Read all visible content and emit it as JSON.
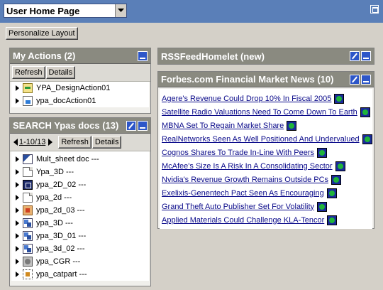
{
  "window": {
    "page_select_value": "User Home Page",
    "maximize_icon": "maximize-icon"
  },
  "toolbar": {
    "personalize_label": "Personalize Layout"
  },
  "my_actions": {
    "title": "My Actions (2)",
    "refresh_label": "Refresh",
    "details_label": "Details",
    "items": [
      {
        "label": "YPA_DesignAction01",
        "icon": "design-action-icon"
      },
      {
        "label": "ypa_docAction01",
        "icon": "doc-action-icon"
      }
    ]
  },
  "search": {
    "title": "SEARCH Ypas docs (13)",
    "pager_label": "1-10/13",
    "refresh_label": "Refresh",
    "details_label": "Details",
    "items": [
      {
        "label": "Mult_sheet doc ---",
        "icon": "multi-sheet-doc-icon"
      },
      {
        "label": "Ypa_3D ---",
        "icon": "document-icon"
      },
      {
        "label": "ypa_2D_02 ---",
        "icon": "drawing-icon"
      },
      {
        "label": "ypa_2d ---",
        "icon": "document-icon"
      },
      {
        "label": "ypa_2d_03 ---",
        "icon": "part-icon"
      },
      {
        "label": "ypa_3D ---",
        "icon": "product-icon"
      },
      {
        "label": "ypa_3D_01 ---",
        "icon": "product-icon"
      },
      {
        "label": "ypa_3d_02 ---",
        "icon": "product-icon"
      },
      {
        "label": "ypa_CGR ---",
        "icon": "cgr-icon"
      },
      {
        "label": "ypa_catpart ---",
        "icon": "catpart-icon"
      }
    ]
  },
  "rss_homelet": {
    "title": "RSSFeedHomelet (new)"
  },
  "forbes": {
    "title": "Forbes.com Financial Market News (10)",
    "items": [
      "Agere's Revenue Could Drop 10% In Fiscal 2005",
      "Satellite Radio Valuations Need To Come Down To Earth",
      "MBNA Set To Regain Market Share",
      "RealNetworks Seen As Well Positioned And Undervalued",
      "Cognos Shares To Trade In-Line With Peers",
      "McAfee's Size Is A Risk In A Consolidating Sector",
      "Nvidia's Revenue Growth Remains Outside PCs",
      "Exelixis-Genentech Pact Seen As Encouraging",
      "Grand Theft Auto Publisher Set For Volatility",
      "Applied Materials Could Challenge KLA-Tencor"
    ]
  }
}
